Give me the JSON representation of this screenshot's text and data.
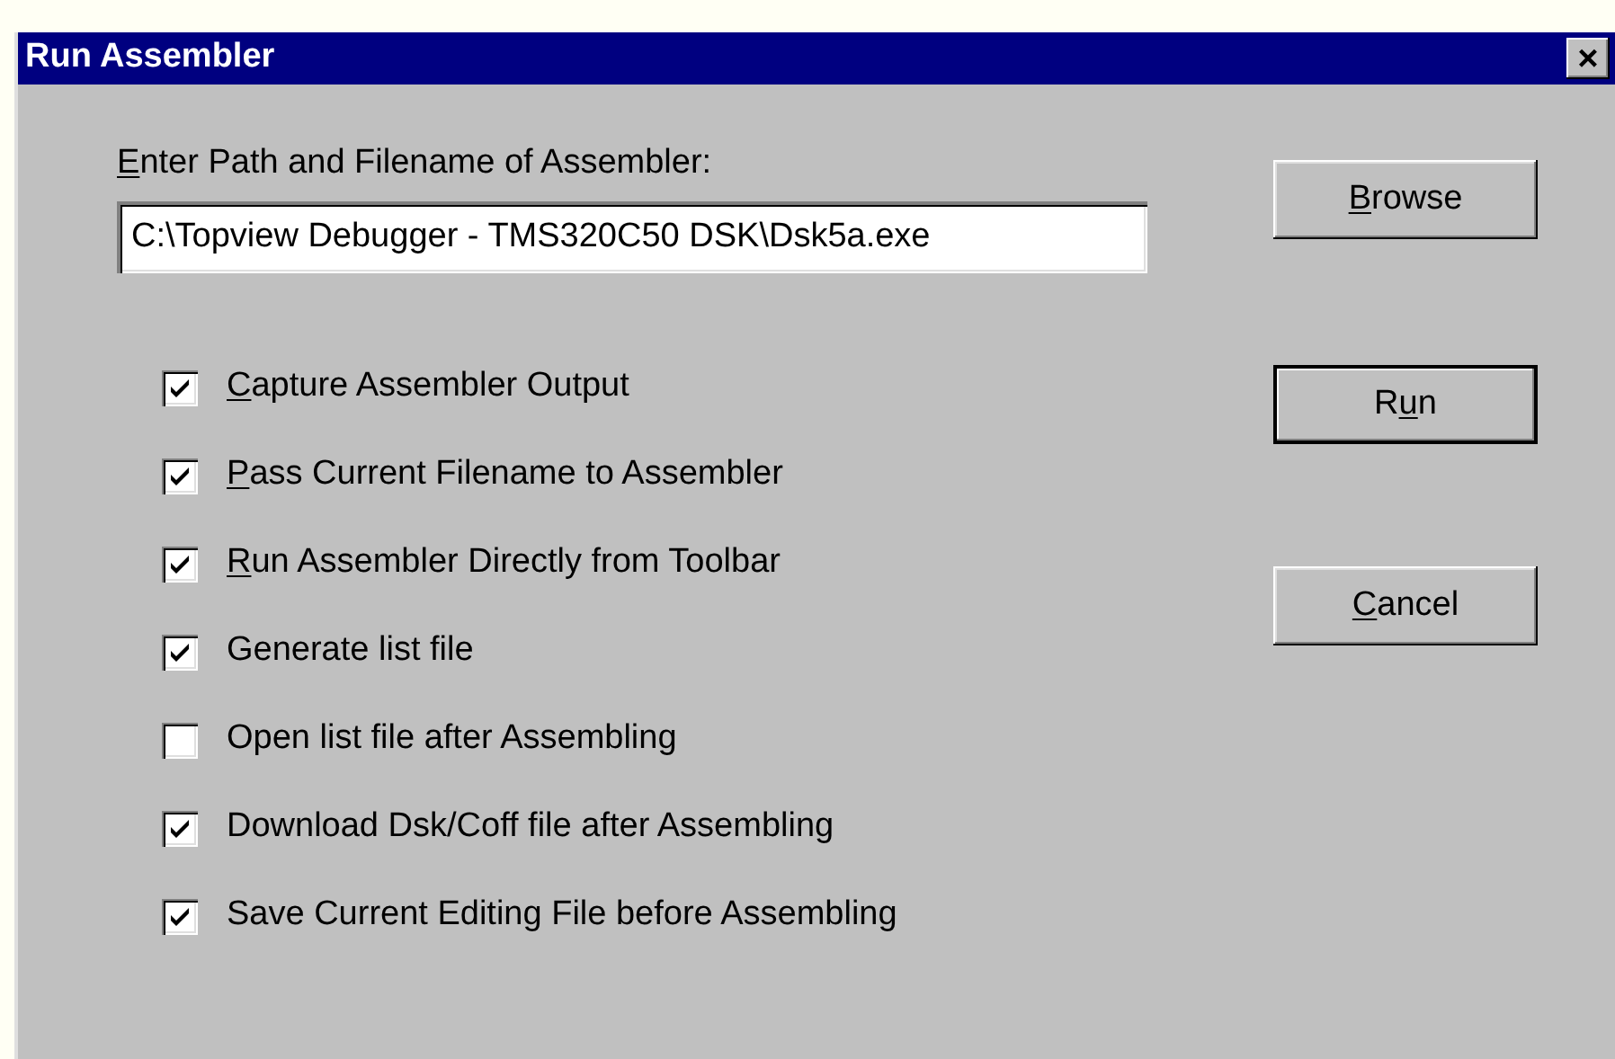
{
  "window": {
    "title": "Run Assembler",
    "close": "×"
  },
  "path": {
    "label": [
      {
        "text": "E",
        "underlined": true
      },
      {
        "text": "nter Path and Filename of Assembler:",
        "underlined": false
      }
    ],
    "value": "C:\\Topview Debugger - TMS320C50 DSK\\Dsk5a.exe"
  },
  "options": [
    {
      "label": [
        {
          "text": "C",
          "underlined": true
        },
        {
          "text": "apture Assembler Output",
          "underlined": false
        }
      ],
      "checked": true
    },
    {
      "label": [
        {
          "text": "P",
          "underlined": true
        },
        {
          "text": "ass Current Filename to Assembler",
          "underlined": false
        }
      ],
      "checked": true
    },
    {
      "label": [
        {
          "text": "R",
          "underlined": true
        },
        {
          "text": "un Assembler Directly from Toolbar",
          "underlined": false
        }
      ],
      "checked": true
    },
    {
      "label": [
        {
          "text": "Generate list file",
          "underlined": false
        }
      ],
      "checked": true
    },
    {
      "label": [
        {
          "text": "Open list file after Assembling",
          "underlined": false
        }
      ],
      "checked": false
    },
    {
      "label": [
        {
          "text": "Download Dsk/Coff file after Assembling",
          "underlined": false
        }
      ],
      "checked": true
    },
    {
      "label": [
        {
          "text": "Save Current Editing File before Assembling",
          "underlined": false
        }
      ],
      "checked": true
    }
  ],
  "buttons": [
    {
      "label": [
        {
          "text": "B",
          "underlined": true
        },
        {
          "text": "rowse",
          "underlined": false
        }
      ],
      "default": false
    },
    {
      "label": [
        {
          "text": "R",
          "underlined": false
        },
        {
          "text": "u",
          "underlined": true
        },
        {
          "text": "n",
          "underlined": false
        }
      ],
      "default": true
    },
    {
      "label": [
        {
          "text": "C",
          "underlined": true
        },
        {
          "text": "ancel",
          "underlined": false
        }
      ],
      "default": false
    }
  ]
}
